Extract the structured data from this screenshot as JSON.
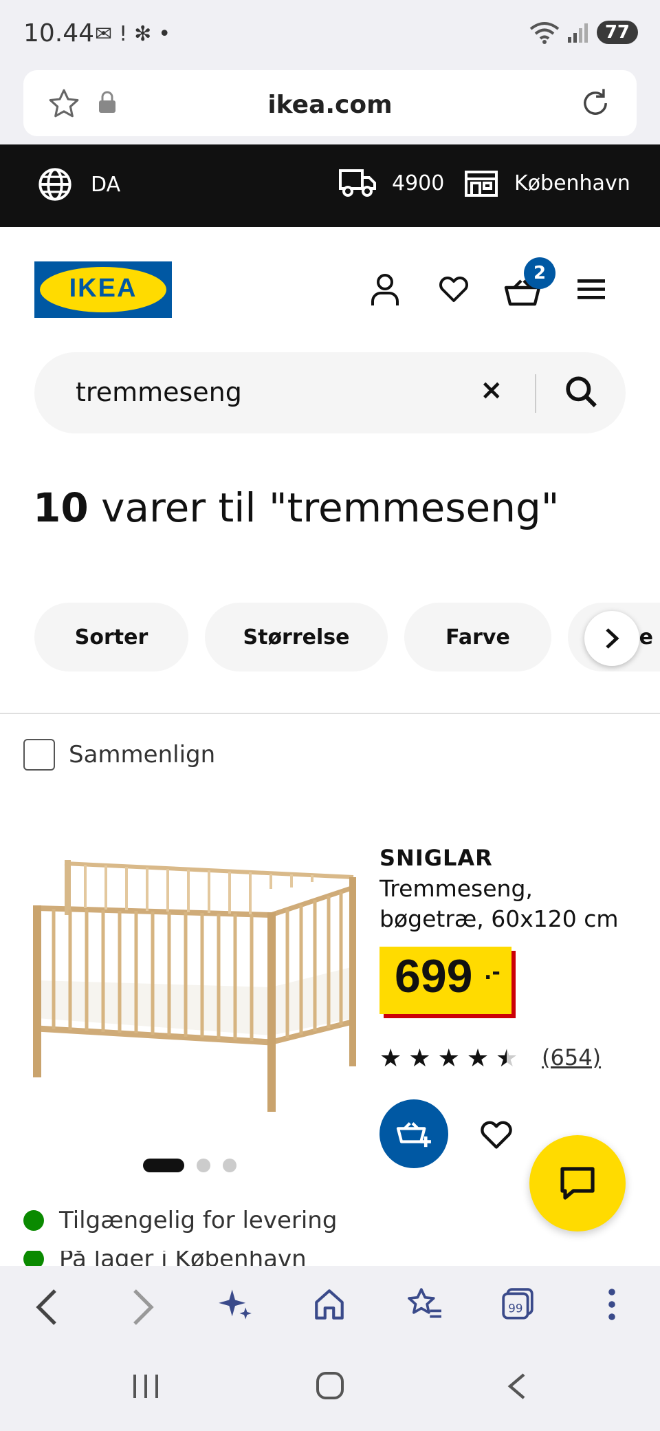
{
  "status": {
    "time": "10.44",
    "battery": "77"
  },
  "browser": {
    "url": "ikea.com"
  },
  "top_banner": {
    "language": "DA",
    "zip": "4900",
    "store": "København"
  },
  "header": {
    "logo": "IKEA",
    "cart_count": "2"
  },
  "search": {
    "value": "tremmeseng"
  },
  "results": {
    "count": "10",
    "text": " varer til \"tremmeseng\""
  },
  "filters": [
    "Sorter",
    "Størrelse",
    "Farve",
    "pe"
  ],
  "compare": {
    "label": "Sammenlign"
  },
  "product": {
    "name": "SNIGLAR",
    "description": "Tremmeseng, bøgetræ, 60x120 cm",
    "price": "699",
    "price_suffix": ".-",
    "rating": 4.5,
    "reviews": "(654)",
    "availability": [
      "Tilgængelig for levering",
      "På lager i København"
    ]
  },
  "colors": {
    "ikea_blue": "#0058a3",
    "ikea_yellow": "#ffdb00",
    "price_red": "#cc0008",
    "available_green": "#0a8a00"
  }
}
